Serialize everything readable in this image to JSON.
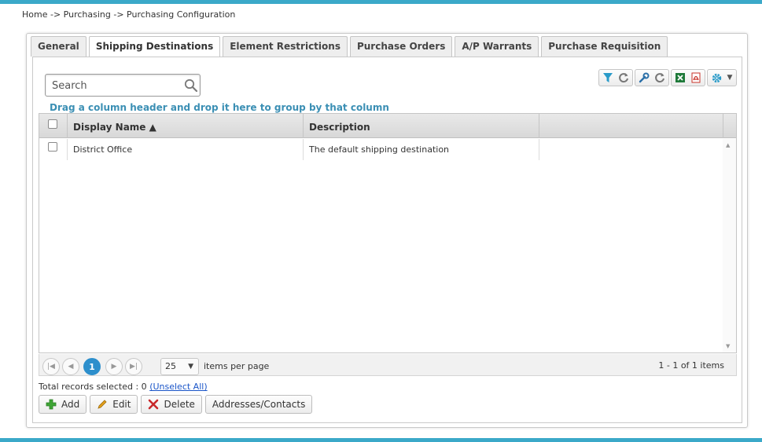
{
  "breadcrumb": "Home -> Purchasing -> Purchasing Configuration",
  "tabs": [
    {
      "label": "General"
    },
    {
      "label": "Shipping Destinations"
    },
    {
      "label": "Element Restrictions"
    },
    {
      "label": "Purchase Orders"
    },
    {
      "label": "A/P Warrants"
    },
    {
      "label": "Purchase Requisition"
    }
  ],
  "active_tab": "Shipping Destinations",
  "search": {
    "placeholder": "Search",
    "value": ""
  },
  "group_hint": "Drag a column header and drop it here to group by that column",
  "grid": {
    "columns": [
      "Display Name ▲",
      "Description",
      ""
    ],
    "sorted_column": "Display Name",
    "sort_direction": "ascending",
    "rows": [
      {
        "display_name": "District Office",
        "description": "The default shipping destination"
      }
    ]
  },
  "pager": {
    "current_page": "1",
    "page_size": "25",
    "per_page_label": "items per page",
    "info": "1 - 1 of 1 items"
  },
  "selection": {
    "text": "Total records selected : 0",
    "unselect_label": "(Unselect All)"
  },
  "actions": {
    "add": "Add",
    "edit": "Edit",
    "delete": "Delete",
    "addresses": "Addresses/Contacts"
  },
  "colors": {
    "accent_bar": "#3ba9c9",
    "group_hint": "#3b8fb4",
    "page_active": "#2d8fcc",
    "link": "#1a55c8"
  }
}
